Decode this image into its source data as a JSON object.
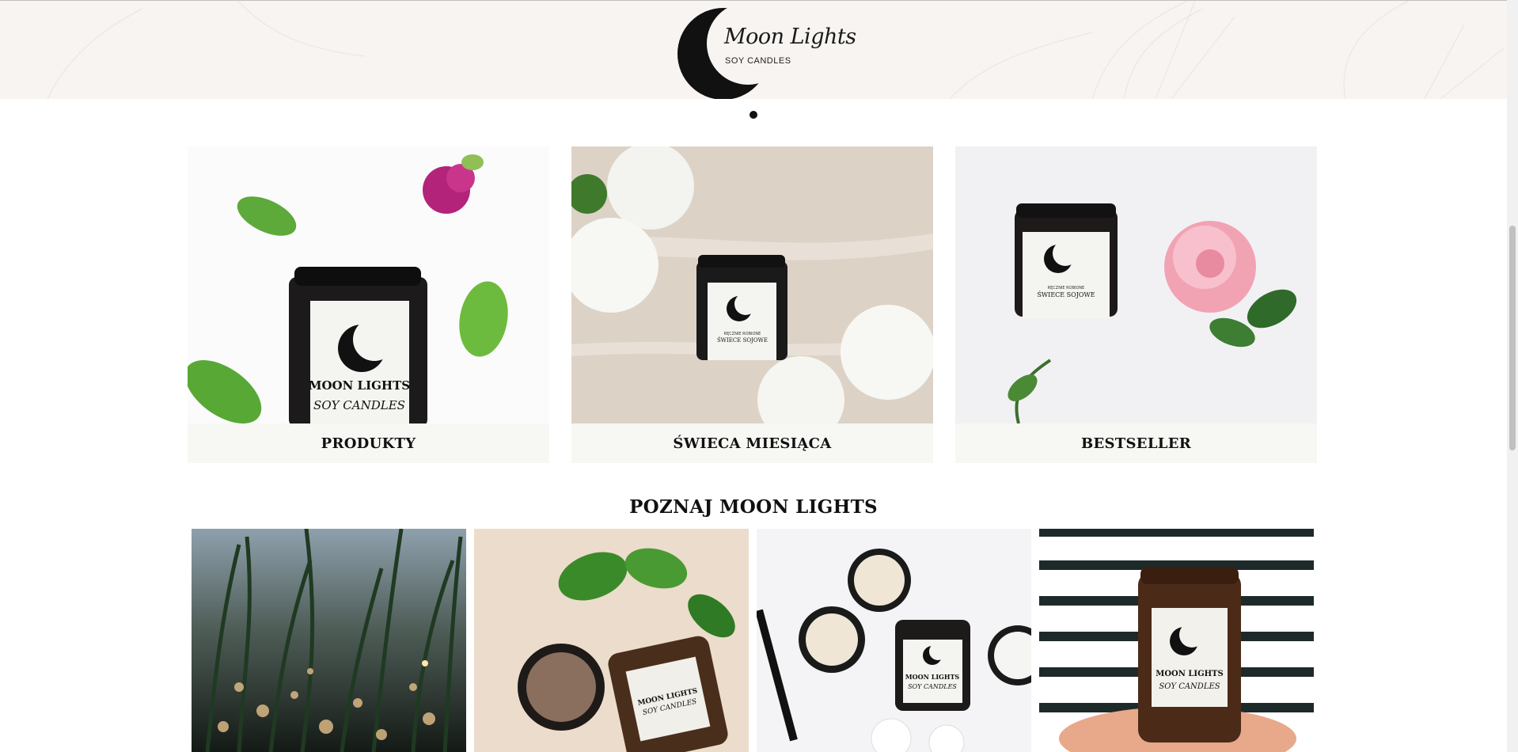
{
  "logo": {
    "script": "Moon Lights",
    "sub": "SOY CANDLES"
  },
  "categories": [
    {
      "label": "PRODUKTY",
      "jar_line1": "MOON LIGHTS",
      "jar_line2": "SOY CANDLES"
    },
    {
      "label": "ŚWIECA MIESIĄCA",
      "jar_line1": "RĘCZNIE ROBIONE",
      "jar_line2": "ŚWIECE SOJOWE"
    },
    {
      "label": "BESTSELLER",
      "jar_line1": "RĘCZNIE ROBIONE",
      "jar_line2": "ŚWIECE SOJOWE"
    }
  ],
  "section_title": "POZNAJ MOON LIGHTS",
  "gallery": [
    {
      "jar_line1": "",
      "jar_line2": ""
    },
    {
      "jar_line1": "MOON LIGHTS",
      "jar_line2": "SOY CANDLES"
    },
    {
      "jar_line1": "MOON LIGHTS",
      "jar_line2": "SOY CANDLES"
    },
    {
      "jar_line1": "MOON LIGHTS",
      "jar_line2": "SOY CANDLES"
    }
  ],
  "colors": {
    "accent": "#111111",
    "hero_bg": "#f7f4f1",
    "caption_bg": "#f6f6f3"
  }
}
